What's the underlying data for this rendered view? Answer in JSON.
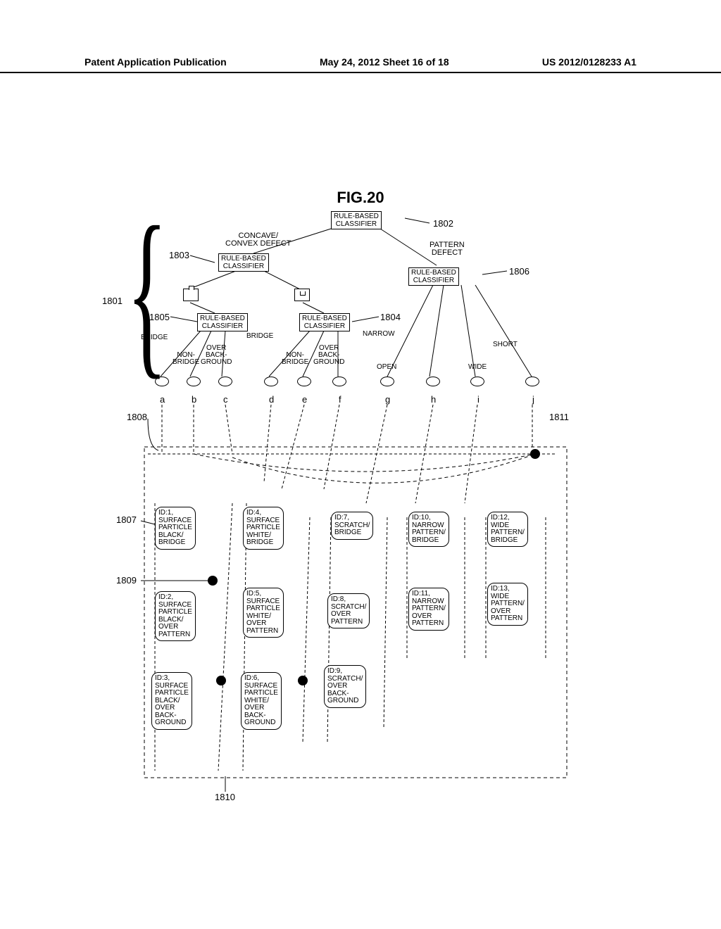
{
  "header": {
    "left": "Patent Application Publication",
    "center": "May 24, 2012  Sheet 16 of 18",
    "right": "US 2012/0128233 A1"
  },
  "figure_title": "FIG.20",
  "labels": {
    "concave_convex": "CONCAVE/\nCONVEX DEFECT",
    "pattern_defect": "PATTERN\nDEFECT",
    "rule_based": "RULE-BASED\nCLASSIFIER",
    "bridge": "BRIDGE",
    "non_bridge": "NON-\nBRIDGE",
    "over_background": "OVER\nBACK-\nGROUND",
    "narrow": "NARROW",
    "open": "OPEN",
    "wide": "WIDE",
    "short": "SHORT"
  },
  "refs": {
    "r1801": "1801",
    "r1802": "1802",
    "r1803": "1803",
    "r1804": "1804",
    "r1805": "1805",
    "r1806": "1806",
    "r1807": "1807",
    "r1808": "1808",
    "r1809": "1809",
    "r1810": "1810",
    "r1811": "1811"
  },
  "letters": [
    "a",
    "b",
    "c",
    "d",
    "e",
    "f",
    "g",
    "h",
    "i",
    "j"
  ],
  "ids": {
    "id1": "ID:1,\nSURFACE\nPARTICLE\nBLACK/\nBRIDGE",
    "id2": "ID:2,\nSURFACE\nPARTICLE\nBLACK/\nOVER\nPATTERN",
    "id3": "ID:3,\nSURFACE\nPARTICLE\nBLACK/\nOVER\nBACK-\nGROUND",
    "id4": "ID:4,\nSURFACE\nPARTICLE\nWHITE/\nBRIDGE",
    "id5": "ID:5,\nSURFACE\nPARTICLE\nWHITE/\nOVER\nPATTERN",
    "id6": "ID:6,\nSURFACE\nPARTICLE\nWHITE/\nOVER\nBACK-\nGROUND",
    "id7": "ID:7,\nSCRATCH/\nBRIDGE",
    "id8": "ID:8,\nSCRATCH/\nOVER\nPATTERN",
    "id9": "ID:9,\nSCRATCH/\nOVER\nBACK-\nGROUND",
    "id10": "ID:10,\nNARROW\nPATTERN/\nBRIDGE",
    "id11": "ID:11,\nNARROW\nPATTERN/\nOVER\nPATTERN",
    "id12": "ID:12,\nWIDE\nPATTERN/\nBRIDGE",
    "id13": "ID:13,\nWIDE\nPATTERN/\nOVER\nPATTERN"
  }
}
